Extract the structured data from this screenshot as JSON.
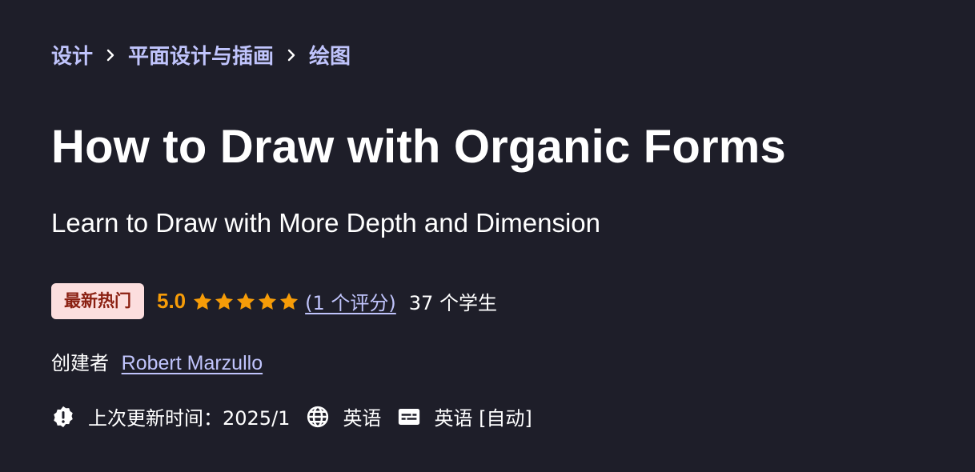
{
  "breadcrumb": {
    "items": [
      "设计",
      "平面设计与插画",
      "绘图"
    ]
  },
  "course": {
    "title": "How to Draw with Organic Forms",
    "subtitle": "Learn to Draw with More Depth and Dimension"
  },
  "rating": {
    "badge": "最新热门",
    "value": "5.0",
    "stars": 5,
    "count_link": "(1 个评分)",
    "students": "37 个学生"
  },
  "creator": {
    "label": "创建者",
    "name": "Robert Marzullo"
  },
  "meta": {
    "updated": "上次更新时间：2025/1",
    "language": "英语",
    "captions": "英语 [自动]"
  },
  "icons": {
    "updated": "alert-badge-icon",
    "language": "globe-icon",
    "captions": "closed-captions-icon"
  },
  "colors": {
    "background": "#1e1e29",
    "link": "#c0c4fc",
    "rating": "#f69c08",
    "badge_bg": "#fcdede",
    "badge_text": "#8a1f11"
  }
}
